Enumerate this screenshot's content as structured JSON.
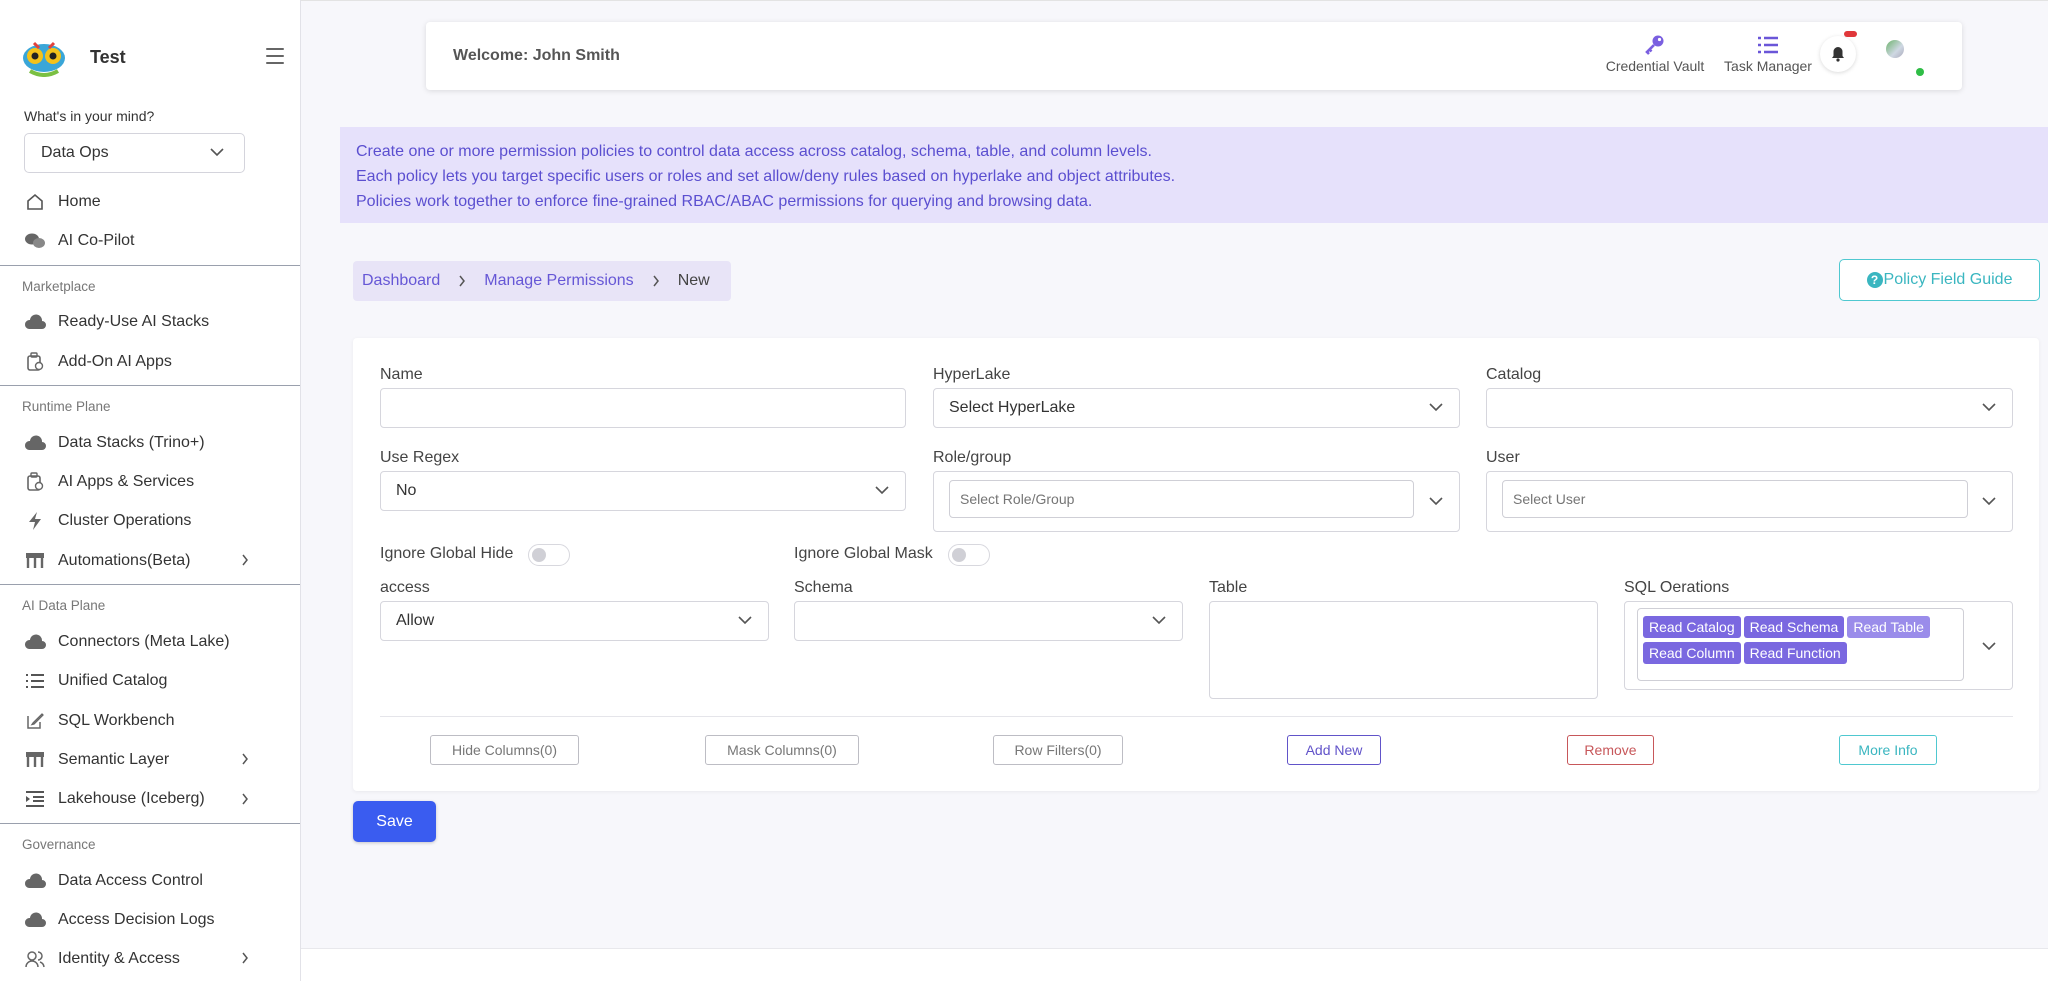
{
  "brand": {
    "name": "Test"
  },
  "sidebar": {
    "prompt_label": "What's in your mind?",
    "selected_mode": "Data Ops",
    "top_items": [
      {
        "label": "Home",
        "icon": "home-icon"
      },
      {
        "label": "AI Co-Pilot",
        "icon": "chat-icon"
      }
    ],
    "sections": [
      {
        "title": "Marketplace",
        "items": [
          {
            "label": "Ready-Use AI Stacks",
            "icon": "cloud-icon"
          },
          {
            "label": "Add-On AI Apps",
            "icon": "apps-icon"
          }
        ]
      },
      {
        "title": "Runtime Plane",
        "items": [
          {
            "label": "Data Stacks (Trino+)",
            "icon": "cloud-icon"
          },
          {
            "label": "AI Apps & Services",
            "icon": "apps-icon"
          },
          {
            "label": "Cluster Operations",
            "icon": "bolt-icon"
          },
          {
            "label": "Automations(Beta)",
            "icon": "hierarchy-icon",
            "expandable": true
          }
        ]
      },
      {
        "title": "AI Data Plane",
        "items": [
          {
            "label": "Connectors (Meta Lake)",
            "icon": "cloud-icon"
          },
          {
            "label": "Unified Catalog",
            "icon": "list-icon"
          },
          {
            "label": "SQL Workbench",
            "icon": "edit-icon"
          },
          {
            "label": "Semantic Layer",
            "icon": "hierarchy-icon",
            "expandable": true
          },
          {
            "label": "Lakehouse (Iceberg)",
            "icon": "indent-icon",
            "expandable": true
          }
        ]
      },
      {
        "title": "Governance",
        "items": [
          {
            "label": "Data Access Control",
            "icon": "cloud-icon"
          },
          {
            "label": "Access Decision Logs",
            "icon": "cloud-icon"
          },
          {
            "label": "Identity & Access",
            "icon": "users-icon",
            "expandable": true
          }
        ]
      }
    ]
  },
  "header": {
    "welcome": "Welcome: John Smith",
    "credential_vault": "Credential Vault",
    "task_manager": "Task Manager"
  },
  "banner": {
    "lines": [
      "Create one or more permission policies to control data access across catalog, schema, table, and column levels.",
      "Each policy lets you target specific users or roles and set allow/deny rules based on hyperlake and object attributes.",
      "Policies work together to enforce fine-grained RBAC/ABAC permissions for querying and browsing data."
    ]
  },
  "breadcrumb": {
    "dashboard": "Dashboard",
    "manage": "Manage Permissions",
    "current": "New"
  },
  "guide_button": "Policy Field Guide",
  "form": {
    "name_label": "Name",
    "name_value": "",
    "hyperlake_label": "HyperLake",
    "hyperlake_value": "Select HyperLake",
    "catalog_label": "Catalog",
    "catalog_value": "",
    "regex_label": "Use Regex",
    "regex_value": "No",
    "role_label": "Role/group",
    "role_placeholder": "Select Role/Group",
    "user_label": "User",
    "user_placeholder": "Select User",
    "ignore_hide_label": "Ignore Global Hide",
    "ignore_mask_label": "Ignore Global Mask",
    "access_label": "access",
    "access_value": "Allow",
    "schema_label": "Schema",
    "schema_value": "",
    "table_label": "Table",
    "sql_label": "SQL Oerations",
    "sql_tags": [
      "Read Catalog",
      "Read Schema",
      "Read Table",
      "Read Column",
      "Read Function"
    ],
    "buttons": {
      "hide_columns": "Hide Columns(0)",
      "mask_columns": "Mask Columns(0)",
      "row_filters": "Row Filters(0)",
      "add_new": "Add New",
      "remove": "Remove",
      "more_info": "More Info"
    }
  },
  "save_label": "Save",
  "colors": {
    "accent": "#6657d6",
    "save": "#3a5cf0",
    "banner_bg": "#e6e1fb",
    "info": "#3ab6c0",
    "danger": "#c7575a"
  }
}
